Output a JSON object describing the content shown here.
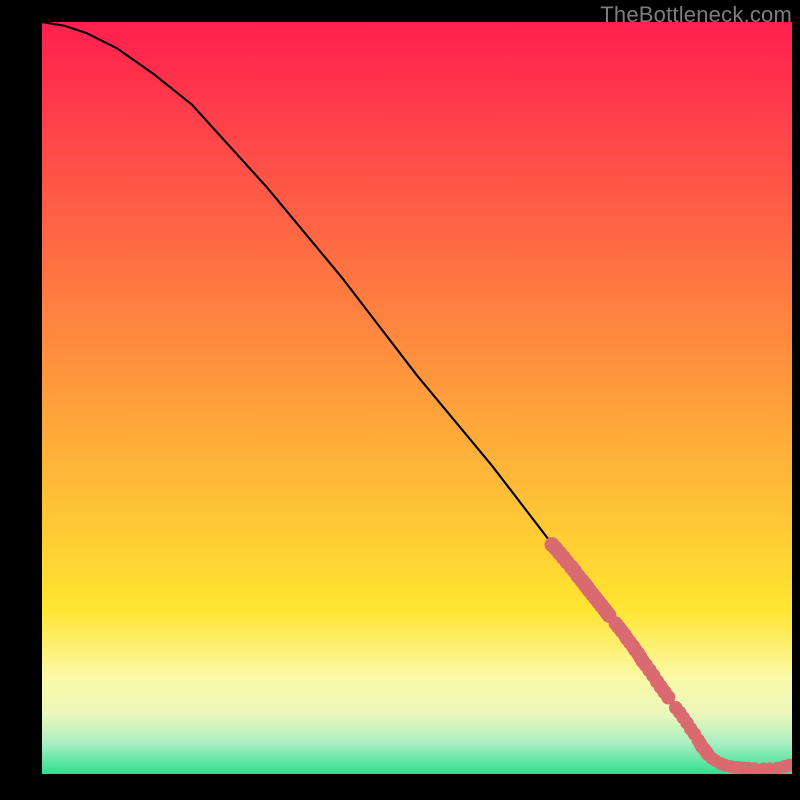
{
  "attribution": "TheBottleneck.com",
  "chart_data": {
    "type": "line",
    "title": "",
    "xlabel": "",
    "ylabel": "",
    "xlim": [
      0,
      100
    ],
    "ylim": [
      0,
      100
    ],
    "gradient_bands": [
      {
        "y0": 0,
        "y1": 78,
        "from": "#ff1f4f",
        "to": "#ffe531"
      },
      {
        "y0": 78,
        "y1": 87,
        "from": "#ffe531",
        "to": "#fbf9a6"
      },
      {
        "y0": 87,
        "y1": 92,
        "from": "#fbf9a6",
        "to": "#ecf7bc"
      },
      {
        "y0": 92,
        "y1": 96,
        "from": "#ecf7bc",
        "to": "#a7eec1"
      },
      {
        "y0": 96,
        "y1": 100,
        "from": "#a7eec1",
        "to": "#2de08e"
      }
    ],
    "series": [
      {
        "name": "bottleneck-curve",
        "x": [
          0,
          3,
          6,
          10,
          15,
          20,
          30,
          40,
          50,
          60,
          70,
          78,
          82,
          86,
          88,
          90,
          92,
          94,
          96,
          100
        ],
        "y": [
          100,
          99.5,
          98.5,
          96.5,
          93,
          89,
          78,
          66,
          53,
          41,
          28,
          18,
          12,
          6.5,
          4,
          2.2,
          1.2,
          0.8,
          0.6,
          1.2
        ]
      }
    ],
    "marker_clusters": [
      {
        "name": "upper-segment",
        "color": "#d96a6f",
        "radius": 1.0,
        "points": [
          [
            68.0,
            30.5
          ],
          [
            68.5,
            30.0
          ],
          [
            69.0,
            29.4
          ],
          [
            69.5,
            28.8
          ],
          [
            70.0,
            28.2
          ],
          [
            70.6,
            27.5
          ],
          [
            71.0,
            27.0
          ],
          [
            71.5,
            26.3
          ],
          [
            72.0,
            25.7
          ],
          [
            72.4,
            25.2
          ],
          [
            72.7,
            24.8
          ],
          [
            73.0,
            24.4
          ],
          [
            73.4,
            23.9
          ],
          [
            73.8,
            23.4
          ],
          [
            74.2,
            22.9
          ],
          [
            74.6,
            22.4
          ],
          [
            75.0,
            21.9
          ],
          [
            75.3,
            21.5
          ],
          [
            75.6,
            21.1
          ]
        ]
      },
      {
        "name": "mid-segment",
        "color": "#d96a6f",
        "radius": 0.95,
        "points": [
          [
            76.5,
            20.0
          ],
          [
            76.9,
            19.5
          ],
          [
            77.3,
            19.0
          ],
          [
            77.7,
            18.5
          ],
          [
            78.0,
            18.0
          ],
          [
            78.4,
            17.5
          ],
          [
            78.8,
            17.0
          ],
          [
            79.1,
            16.5
          ],
          [
            79.5,
            16.0
          ],
          [
            79.8,
            15.5
          ],
          [
            80.1,
            15.0
          ],
          [
            80.5,
            14.5
          ],
          [
            81.0,
            13.8
          ],
          [
            81.5,
            13.1
          ],
          [
            82.0,
            12.3
          ],
          [
            82.5,
            11.6
          ],
          [
            83.0,
            10.9
          ],
          [
            83.5,
            10.2
          ]
        ]
      },
      {
        "name": "lower-segment",
        "color": "#d96a6f",
        "radius": 0.9,
        "points": [
          [
            84.5,
            8.8
          ],
          [
            85.0,
            8.2
          ],
          [
            85.5,
            7.5
          ],
          [
            86.0,
            6.8
          ],
          [
            86.5,
            6.0
          ],
          [
            87.0,
            5.3
          ],
          [
            87.5,
            4.5
          ],
          [
            87.8,
            4.0
          ],
          [
            88.0,
            3.6
          ],
          [
            88.3,
            3.3
          ],
          [
            88.6,
            2.9
          ],
          [
            88.8,
            2.6
          ]
        ]
      },
      {
        "name": "flat-tail",
        "color": "#d96a6f",
        "radius": 0.85,
        "points": [
          [
            89.3,
            2.1
          ],
          [
            89.8,
            1.8
          ],
          [
            90.5,
            1.4
          ],
          [
            91.0,
            1.2
          ],
          [
            91.8,
            1.0
          ],
          [
            92.5,
            0.9
          ],
          [
            93.0,
            0.85
          ],
          [
            93.6,
            0.8
          ],
          [
            94.2,
            0.77
          ],
          [
            95.0,
            0.72
          ],
          [
            96.2,
            0.68
          ],
          [
            97.0,
            0.7
          ],
          [
            98.1,
            0.8
          ],
          [
            99.0,
            1.0
          ],
          [
            99.7,
            1.2
          ]
        ]
      }
    ]
  }
}
